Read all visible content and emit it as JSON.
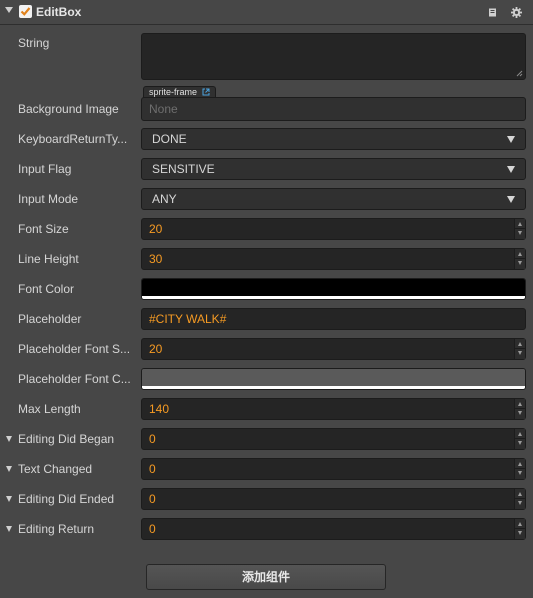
{
  "component": {
    "title": "EditBox",
    "enabled": true
  },
  "props": {
    "string": {
      "label": "String",
      "value": ""
    },
    "background_image": {
      "label": "Background Image",
      "tag": "sprite-frame",
      "value": "None"
    },
    "keyboard_return_type": {
      "label": "KeyboardReturnTy...",
      "value": "DONE"
    },
    "input_flag": {
      "label": "Input Flag",
      "value": "SENSITIVE"
    },
    "input_mode": {
      "label": "Input Mode",
      "value": "ANY"
    },
    "font_size": {
      "label": "Font Size",
      "value": "20"
    },
    "line_height": {
      "label": "Line Height",
      "value": "30"
    },
    "font_color": {
      "label": "Font Color",
      "color": "#000000"
    },
    "placeholder": {
      "label": "Placeholder",
      "value": "#CITY WALK#"
    },
    "placeholder_font_size": {
      "label": "Placeholder Font S...",
      "value": "20"
    },
    "placeholder_font_color": {
      "label": "Placeholder Font C...",
      "color": "#5a5a5a"
    },
    "max_length": {
      "label": "Max Length",
      "value": "140"
    }
  },
  "events": [
    {
      "label": "Editing Did Began",
      "value": "0"
    },
    {
      "label": "Text Changed",
      "value": "0"
    },
    {
      "label": "Editing Did Ended",
      "value": "0"
    },
    {
      "label": "Editing Return",
      "value": "0"
    }
  ],
  "footer": {
    "add_component_label": "添加组件"
  },
  "colors": {
    "accent_number": "#f59a23",
    "panel_bg": "#474747",
    "field_bg": "#252525"
  },
  "icons": {
    "fold": "triangle-down-icon",
    "enabled": "checkbox-icon",
    "help": "book-icon",
    "settings": "gear-icon"
  }
}
